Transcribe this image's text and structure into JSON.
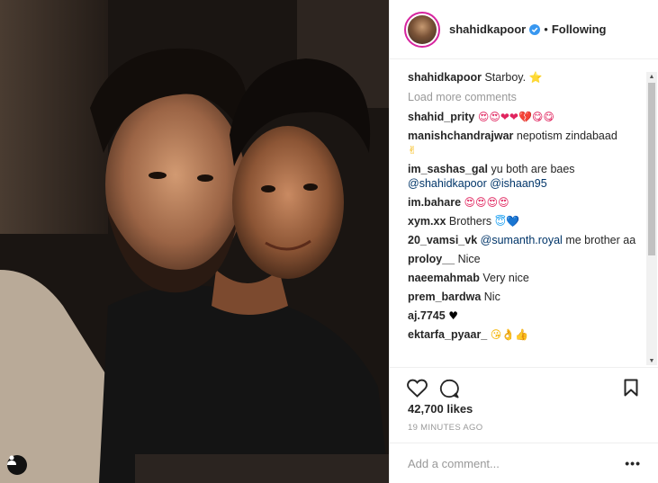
{
  "post": {
    "username": "shahidkapoor",
    "separator": "•",
    "follow_status": "Following",
    "caption_user": "shahidkapoor",
    "caption_text": "Starboy.",
    "caption_emoji": "⭐",
    "load_more": "Load more comments",
    "likes": "42,700 likes",
    "time_ago": "19 MINUTES AGO",
    "add_comment_placeholder": "Add a comment...",
    "more_options": "•••"
  },
  "comments": [
    {
      "user": "shahid_prity",
      "text": "",
      "emoji": "😍😍❤❤💔😋😋"
    },
    {
      "user": "manishchandrajwar",
      "text": "nepotism zindabaad",
      "emoji": "✌"
    },
    {
      "user": "im_sashas_gal",
      "text": "yu both are baes",
      "mentions": "@shahidkapoor @ishaan95"
    },
    {
      "user": "im.bahare",
      "text": "",
      "emoji": "😍😍😍😍"
    },
    {
      "user": "xym.xx",
      "text": "Brothers",
      "emoji": "😇💙"
    },
    {
      "user": "20_vamsi_vk",
      "mention": "@sumanth.royal",
      "text": "me brother aa"
    },
    {
      "user": "proloy__",
      "text": "Nice"
    },
    {
      "user": "naeemahmab",
      "text": "Very nice"
    },
    {
      "user": "prem_bardwa",
      "text": "Nic"
    },
    {
      "user": "aj.7745",
      "text": "",
      "emoji": "♥"
    },
    {
      "user": "ektarfa_pyaar_",
      "text": "",
      "emoji": "😘👌👍"
    }
  ],
  "icons": {
    "verified": "verified-badge-icon",
    "heart": "heart-icon",
    "comment": "comment-icon",
    "save": "bookmark-icon",
    "tag": "user-tag-icon"
  },
  "colors": {
    "mention": "#003569",
    "verified": "#3897f0",
    "muted": "#999999",
    "text": "#262626"
  }
}
